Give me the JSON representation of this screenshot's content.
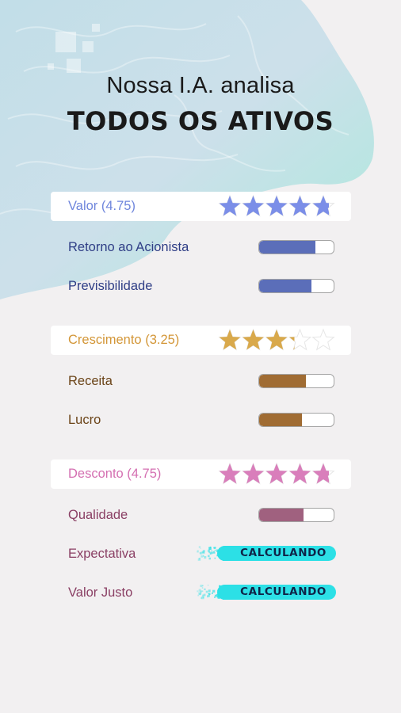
{
  "headline": {
    "line1": "Nossa I.A. analisa",
    "line2": "TODOS OS ATIVOS"
  },
  "categories": [
    {
      "label": "Valor (4.75)",
      "rating": 4.75,
      "color": "#6f86dc",
      "star_color": "#7b8ee8",
      "rows": [
        {
          "label": "Retorno ao Acionista",
          "level": 0.75,
          "bar_color": "#5b6eb9"
        },
        {
          "label": "Previsibilidade",
          "level": 0.7,
          "bar_color": "#5b6eb9"
        }
      ]
    },
    {
      "label": "Crescimento (3.25)",
      "rating": 3.25,
      "color": "#d39637",
      "star_color": "#d9a94b",
      "rows": [
        {
          "label": "Receita",
          "level": 0.63,
          "bar_color": "#a06c33"
        },
        {
          "label": "Lucro",
          "level": 0.57,
          "bar_color": "#a06c33"
        }
      ]
    },
    {
      "label": "Desconto (4.75)",
      "rating": 4.75,
      "color": "#d46fb1",
      "star_color": "#d97ebb",
      "rows": [
        {
          "label": "Qualidade",
          "level": 0.6,
          "bar_color": "#a0617f"
        },
        {
          "label": "Expectativa",
          "status": "CALCULANDO"
        },
        {
          "label": "Valor Justo",
          "status": "CALCULANDO"
        }
      ]
    }
  ],
  "text_colors": {
    "valor_rows": "#2f3e86",
    "crescimento_rows": "#6b4418",
    "desconto_rows": "#8a3f64"
  },
  "icons": {
    "brain_background": "brain-illustration",
    "star": "star-icon"
  }
}
